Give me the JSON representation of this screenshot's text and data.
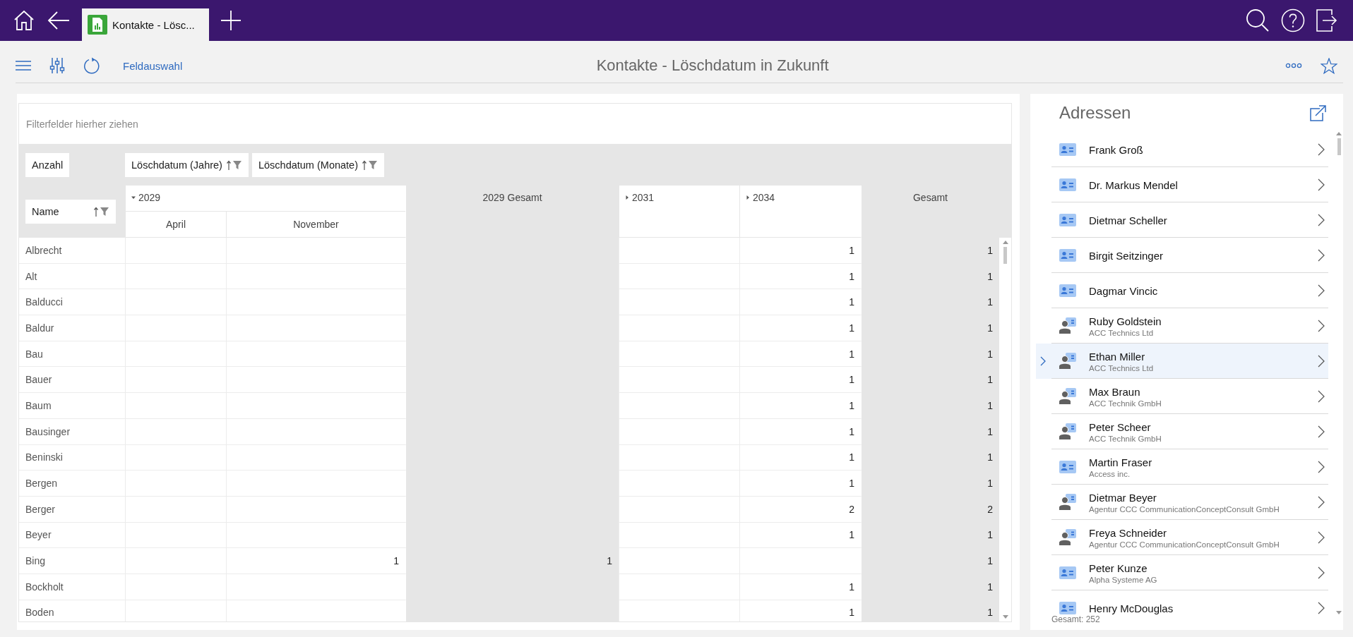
{
  "tabs": [
    {
      "label": "Kontakte - Lösc...",
      "selected": true
    }
  ],
  "toolbar": {
    "field_link": "Feldauswahl",
    "title": "Kontakte - Löschdatum in Zukunft"
  },
  "pivot": {
    "filter_placeholder": "Filterfelder hierher ziehen",
    "data_field": "Anzahl",
    "column_fields": [
      {
        "label": "Löschdatum (Jahre)"
      },
      {
        "label": "Löschdatum (Monate)"
      }
    ],
    "row_field": {
      "label": "Name"
    },
    "column_headers": [
      {
        "kind": "year",
        "label": "2029",
        "expanded": true,
        "children": [
          {
            "label": "April"
          },
          {
            "label": "November"
          }
        ]
      },
      {
        "kind": "total",
        "label": "2029 Gesamt"
      },
      {
        "kind": "year",
        "label": "2031",
        "expanded": false
      },
      {
        "kind": "year",
        "label": "2034",
        "expanded": false
      },
      {
        "kind": "total",
        "label": "Gesamt"
      }
    ],
    "rows": [
      {
        "name": "Albrecht",
        "y2034": "1",
        "total": "1"
      },
      {
        "name": "Alt",
        "y2034": "1",
        "total": "1"
      },
      {
        "name": "Balducci",
        "y2034": "1",
        "total": "1"
      },
      {
        "name": "Baldur",
        "y2034": "1",
        "total": "1"
      },
      {
        "name": "Bau",
        "y2034": "1",
        "total": "1"
      },
      {
        "name": "Bauer",
        "y2034": "1",
        "total": "1"
      },
      {
        "name": "Baum",
        "y2034": "1",
        "total": "1"
      },
      {
        "name": "Bausinger",
        "y2034": "1",
        "total": "1"
      },
      {
        "name": "Beninski",
        "y2034": "1",
        "total": "1"
      },
      {
        "name": "Bergen",
        "y2034": "1",
        "total": "1"
      },
      {
        "name": "Berger",
        "y2034": "2",
        "total": "2"
      },
      {
        "name": "Beyer",
        "y2034": "1",
        "total": "1"
      },
      {
        "name": "Bing",
        "november": "1",
        "total_2029": "1",
        "total": "1"
      },
      {
        "name": "Bockholt",
        "y2034": "1",
        "total": "1"
      },
      {
        "name": "Boden",
        "y2034": "1",
        "total": "1"
      }
    ]
  },
  "addresses": {
    "title": "Adressen",
    "items": [
      {
        "kind": "contact",
        "name": "Frank Groß",
        "selected": false
      },
      {
        "kind": "contact",
        "name": "Dr. Markus Mendel",
        "selected": false
      },
      {
        "kind": "contact",
        "name": "Dietmar Scheller",
        "selected": false
      },
      {
        "kind": "contact",
        "name": "Birgit Seitzinger",
        "selected": false
      },
      {
        "kind": "contact",
        "name": "Dagmar Vincic",
        "selected": false
      },
      {
        "kind": "person",
        "name": "Ruby Goldstein",
        "company": "ACC Technics Ltd",
        "selected": false
      },
      {
        "kind": "person",
        "name": "Ethan Miller",
        "company": "ACC Technics Ltd",
        "selected": true
      },
      {
        "kind": "person",
        "name": "Max Braun",
        "company": "ACC Technik GmbH",
        "selected": false
      },
      {
        "kind": "person",
        "name": "Peter Scheer",
        "company": "ACC Technik GmbH",
        "selected": false
      },
      {
        "kind": "contact",
        "name": "Martin Fraser",
        "company": "Access inc.",
        "selected": false
      },
      {
        "kind": "person",
        "name": "Dietmar Beyer",
        "company": "Agentur CCC CommunicationConceptConsult GmbH",
        "selected": false
      },
      {
        "kind": "person",
        "name": "Freya Schneider",
        "company": "Agentur CCC CommunicationConceptConsult GmbH",
        "selected": false
      },
      {
        "kind": "contact",
        "name": "Peter Kunze",
        "company": "Alpha Systeme AG",
        "selected": false
      },
      {
        "kind": "contact",
        "name": "Henry McDouglas",
        "selected": false
      }
    ],
    "total": "Gesamt: 252"
  }
}
